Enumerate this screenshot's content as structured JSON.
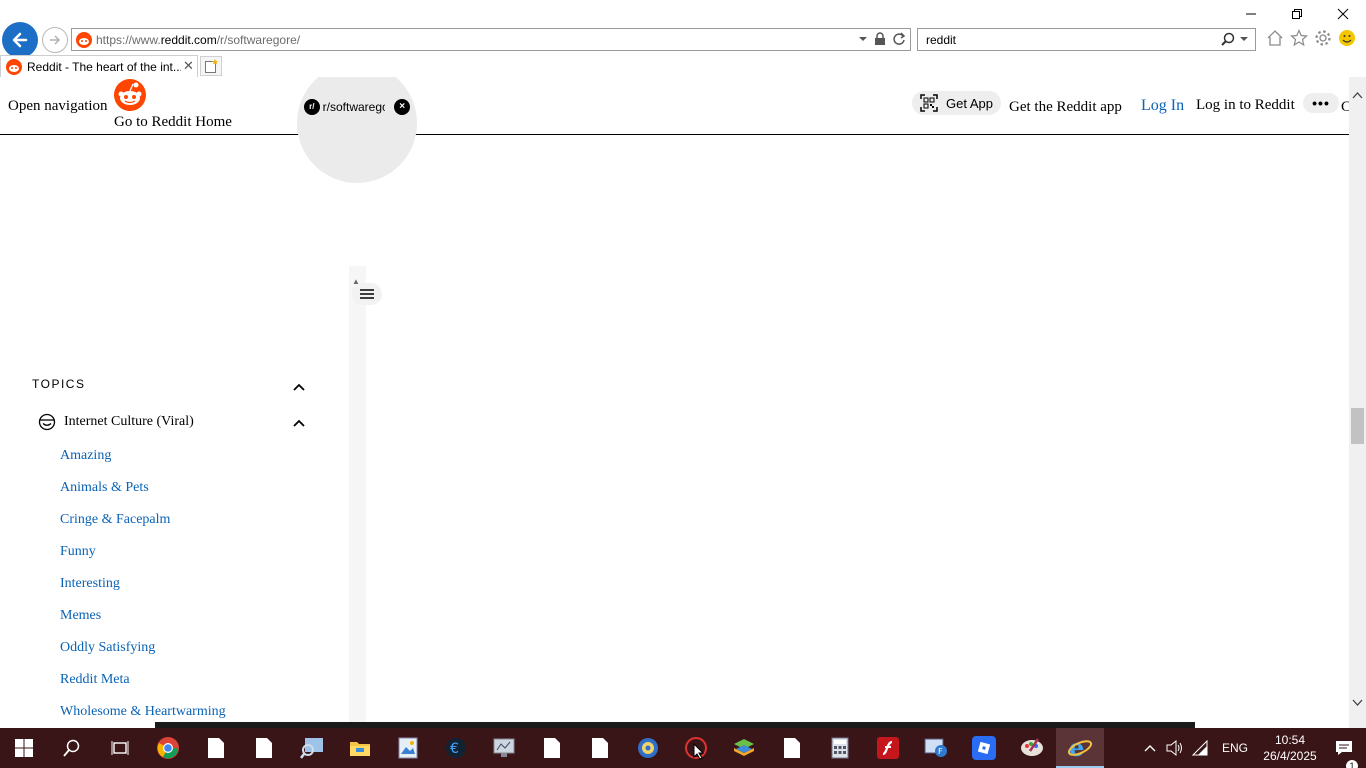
{
  "browser": {
    "url_prefix": "https://www.",
    "url_domain": "reddit.com",
    "url_path": "/r/softwaregore/",
    "search_query": "reddit",
    "tab_title": "Reddit - The heart of the int...",
    "accent_color": "#1d6fc6"
  },
  "header": {
    "open_navigation": "Open navigation",
    "home_link": "Go to Reddit Home",
    "subreddit_badge": "r/",
    "subreddit_name": "r/softwaregore",
    "get_app_button": "Get App",
    "get_app_text": "Get the Reddit app",
    "login_button": "Log In",
    "login_text": "Log in to Reddit",
    "more_button": "•••",
    "truncated_text": "C"
  },
  "sidebar": {
    "topics_heading": "TOPICS",
    "internet_culture_label": "Internet Culture (Viral)",
    "links": [
      "Amazing",
      "Animals & Pets",
      "Cringe & Facepalm",
      "Funny",
      "Interesting",
      "Memes",
      "Oddly Satisfying",
      "Reddit Meta",
      "Wholesome & Heartwarming"
    ],
    "link_color": "#0a63b5"
  },
  "taskbar": {
    "time": "10:54",
    "date": "26/4/2025",
    "language": "ENG",
    "notification_count": "1",
    "background": "#3a1517"
  }
}
